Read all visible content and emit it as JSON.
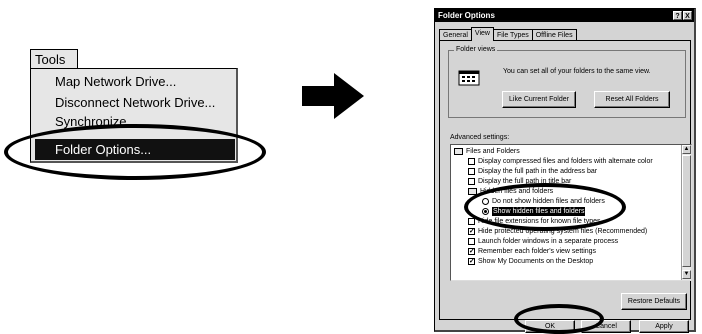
{
  "tools_menu": {
    "title": "Tools",
    "items": [
      {
        "label": "Map Network Drive..."
      },
      {
        "label": "Disconnect Network Drive..."
      },
      {
        "label": "Synchronize..."
      },
      {
        "label": "Folder Options..."
      }
    ],
    "selected_index": 3
  },
  "arrow_icon": "right-arrow-icon",
  "dialog": {
    "title": "Folder Options",
    "title_buttons": {
      "help": "?",
      "close": "X"
    },
    "tabs": [
      {
        "label": "General"
      },
      {
        "label": "View"
      },
      {
        "label": "File Types"
      },
      {
        "label": "Offline Files"
      }
    ],
    "active_tab": "View",
    "folder_views": {
      "legend": "Folder views",
      "description": "You can set all of your folders to the same view.",
      "like_current_button": "Like Current Folder",
      "reset_all_button": "Reset All Folders"
    },
    "advanced_label": "Advanced settings:",
    "settings": [
      {
        "type": "folder",
        "label": "Files and Folders"
      },
      {
        "type": "checkbox",
        "label": "Display compressed files and folders with alternate color",
        "checked": false
      },
      {
        "type": "checkbox",
        "label": "Display the full path in the address bar",
        "checked": false
      },
      {
        "type": "checkbox",
        "label": "Display the full path in title bar",
        "checked": false
      },
      {
        "type": "folder",
        "label": "Hidden files and folders"
      },
      {
        "type": "radio",
        "label": "Do not show hidden files and folders",
        "checked": false
      },
      {
        "type": "radio",
        "label": "Show hidden files and folders",
        "checked": true
      },
      {
        "type": "checkbox",
        "label": "Hide file extensions for known file types",
        "checked": false
      },
      {
        "type": "checkbox",
        "label": "Hide protected operating system files (Recommended)",
        "checked": true
      },
      {
        "type": "checkbox",
        "label": "Launch folder windows in a separate process",
        "checked": false
      },
      {
        "type": "checkbox",
        "label": "Remember each folder's view settings",
        "checked": true
      },
      {
        "type": "checkbox",
        "label": "Show My Documents on the Desktop",
        "checked": true
      }
    ],
    "restore_defaults_button": "Restore Defaults",
    "ok_button": "OK",
    "cancel_button": "Cancel",
    "apply_button": "Apply"
  },
  "colors": {
    "highlight": "#111111",
    "dialog_face": "#d4d4d4",
    "menu_face": "#e6e6e6"
  }
}
